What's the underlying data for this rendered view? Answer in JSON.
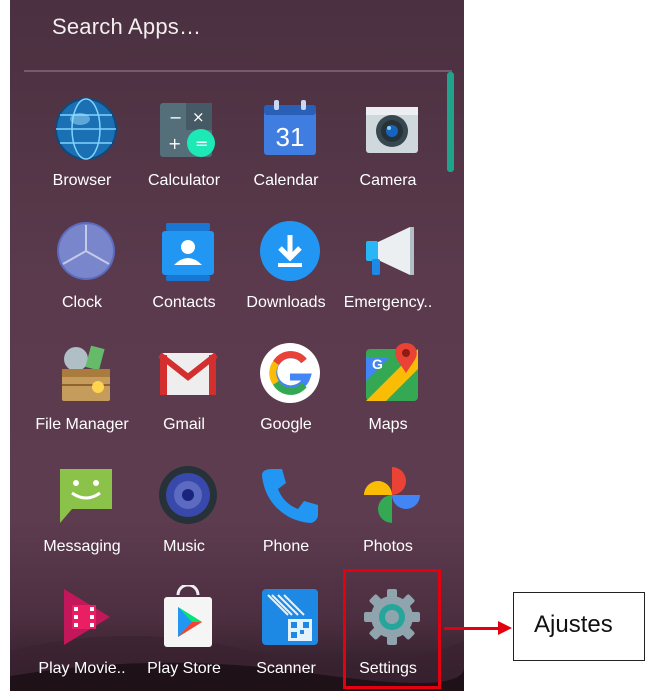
{
  "search": {
    "placeholder": "Search Apps…"
  },
  "apps": [
    {
      "label": "Browser",
      "icon": "browser-globe-icon"
    },
    {
      "label": "Calculator",
      "icon": "calculator-icon"
    },
    {
      "label": "Calendar",
      "icon": "calendar-icon",
      "day": "31"
    },
    {
      "label": "Camera",
      "icon": "camera-icon"
    },
    {
      "label": "Clock",
      "icon": "clock-icon"
    },
    {
      "label": "Contacts",
      "icon": "contacts-icon"
    },
    {
      "label": "Downloads",
      "icon": "download-icon"
    },
    {
      "label": "Emergency..",
      "icon": "megaphone-icon"
    },
    {
      "label": "File Manager",
      "icon": "file-manager-icon"
    },
    {
      "label": "Gmail",
      "icon": "gmail-icon"
    },
    {
      "label": "Google",
      "icon": "google-g-icon"
    },
    {
      "label": "Maps",
      "icon": "maps-icon"
    },
    {
      "label": "Messaging",
      "icon": "messaging-icon"
    },
    {
      "label": "Music",
      "icon": "speaker-icon"
    },
    {
      "label": "Phone",
      "icon": "phone-icon"
    },
    {
      "label": "Photos",
      "icon": "pinwheel-icon"
    },
    {
      "label": "Play Movie..",
      "icon": "play-movies-icon"
    },
    {
      "label": "Play Store",
      "icon": "play-store-icon"
    },
    {
      "label": "Scanner",
      "icon": "barcode-scanner-icon"
    },
    {
      "label": "Settings",
      "icon": "gear-icon"
    }
  ],
  "annotation": {
    "label": "Ajustes",
    "color": "#e3000f"
  },
  "colors": {
    "accent": "#1fa38a"
  }
}
